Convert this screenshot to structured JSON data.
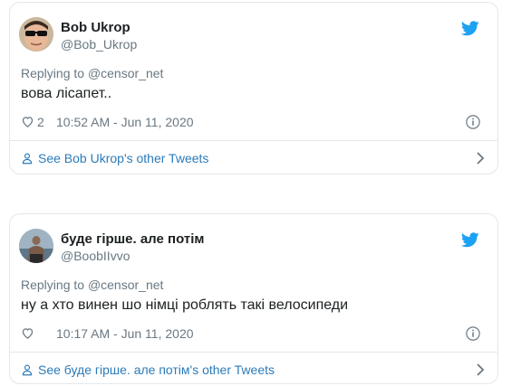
{
  "colors": {
    "border": "#e1e8ed",
    "text": "#1c2022",
    "secondary": "#697882",
    "link": "#2b7bb9",
    "twitter_blue": "#1da1f2"
  },
  "tweets": [
    {
      "author_name": "Bob Ukrop",
      "author_handle": "@Bob_Ukrop",
      "replying_prefix": "Replying to ",
      "replying_to": "@censor_net",
      "text": "вова лісапет..",
      "likes": "2",
      "timestamp": "10:52 AM - Jun 11, 2020",
      "other_tweets_link": "See Bob Ukrop's other Tweets",
      "icons": {
        "like": "heart-icon",
        "info": "info-icon",
        "brand": "twitter-bird-icon",
        "profile": "person-icon",
        "chevron": "chevron-right-icon"
      }
    },
    {
      "author_name": "буде гірше. але потім",
      "author_handle": "@BoobIIvvo",
      "replying_prefix": "Replying to ",
      "replying_to": "@censor_net",
      "text": "ну а хто винен шо німці роблять такі велосипеди",
      "likes": "",
      "timestamp": "10:17 AM - Jun 11, 2020",
      "other_tweets_link": "See буде гірше. але потім's other Tweets",
      "icons": {
        "like": "heart-icon",
        "info": "info-icon",
        "brand": "twitter-bird-icon",
        "profile": "person-icon",
        "chevron": "chevron-right-icon"
      }
    }
  ]
}
